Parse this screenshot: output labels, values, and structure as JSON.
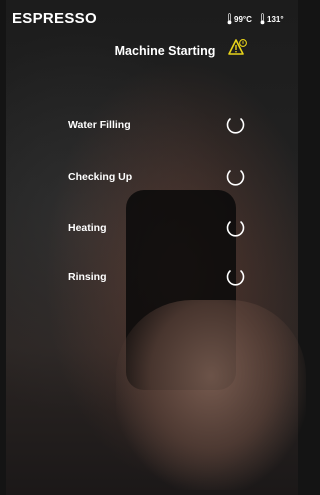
{
  "header": {
    "brand": "ESPRESSO",
    "temp_1": "99°C",
    "temp_2": "131°",
    "title": "Machine Starting",
    "warning_icon": "warning-triangle-icon"
  },
  "steps": [
    {
      "label": "Water Filling",
      "status_icon": "loading-spinner-icon"
    },
    {
      "label": "Checking Up",
      "status_icon": "loading-spinner-icon"
    },
    {
      "label": "Heating",
      "status_icon": "loading-spinner-icon"
    },
    {
      "label": "Rinsing",
      "status_icon": "loading-spinner-icon"
    }
  ],
  "colors": {
    "text": "#ffffff",
    "warning": "#e8d31a"
  }
}
